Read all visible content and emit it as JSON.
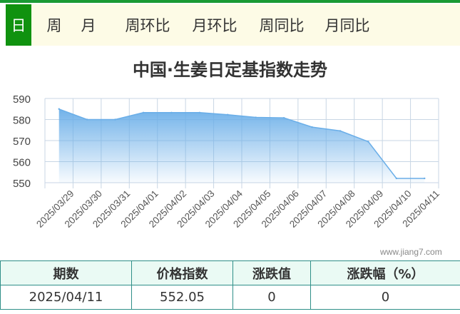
{
  "tabs": [
    {
      "label": "日",
      "active": true
    },
    {
      "label": "周",
      "active": false
    },
    {
      "label": "月",
      "active": false
    },
    {
      "label": "周环比",
      "active": false
    },
    {
      "label": "月环比",
      "active": false
    },
    {
      "label": "周同比",
      "active": false
    },
    {
      "label": "月同比",
      "active": false
    }
  ],
  "chart_data": {
    "type": "area",
    "title": "中国·生姜日定基指数走势",
    "x": [
      "2025/03/29",
      "2025/03/30",
      "2025/03/31",
      "2025/04/01",
      "2025/04/02",
      "2025/04/03",
      "2025/04/04",
      "2025/04/05",
      "2025/04/06",
      "2025/04/07",
      "2025/04/08",
      "2025/04/09",
      "2025/04/10",
      "2025/04/11"
    ],
    "values": [
      585.0,
      580.0,
      580.0,
      583.3,
      583.3,
      583.3,
      582.3,
      581.0,
      580.8,
      576.4,
      574.6,
      569.5,
      552.05,
      552.05
    ],
    "yticks": [
      550,
      560,
      570,
      580,
      590
    ],
    "ylim": [
      550,
      590
    ],
    "grid": true,
    "fill_color": "#6aaee8",
    "line_color": "#6aaee8"
  },
  "watermark": "www.jiang7.com",
  "table": {
    "headers": [
      "期数",
      "价格指数",
      "涨跌值",
      "涨跌幅（%）"
    ],
    "row": [
      "2025/04/11",
      "552.05",
      "0",
      "0"
    ]
  },
  "colors": {
    "accent": "#10920f",
    "table_border": "#2f8f88",
    "header_bg": "#eafaf4"
  }
}
